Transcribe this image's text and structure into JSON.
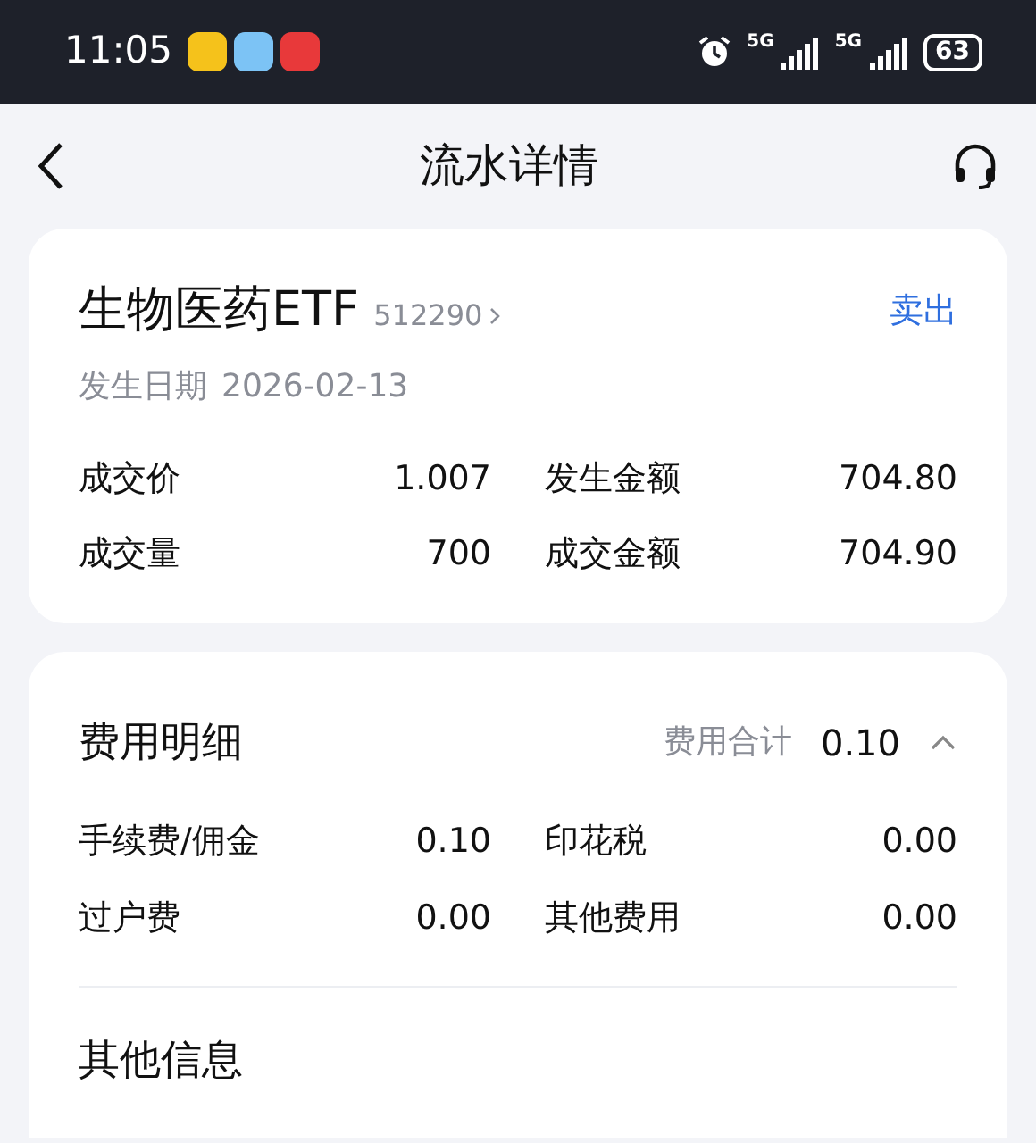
{
  "status_bar": {
    "time": "11:05",
    "networks": [
      "5G",
      "5G"
    ],
    "battery": "63"
  },
  "header": {
    "title": "流水详情"
  },
  "trade": {
    "name": "生物医药ETF",
    "code": "512290",
    "action": "卖出",
    "date_label": "发生日期",
    "date": "2026-02-13",
    "fields": [
      {
        "label": "成交价",
        "value": "1.007"
      },
      {
        "label": "发生金额",
        "value": "704.80"
      },
      {
        "label": "成交量",
        "value": "700"
      },
      {
        "label": "成交金额",
        "value": "704.90"
      }
    ]
  },
  "fees": {
    "title": "费用明细",
    "total_label": "费用合计",
    "total": "0.10",
    "expanded": true,
    "items": [
      {
        "label": "手续费/佣金",
        "value": "0.10"
      },
      {
        "label": "印花税",
        "value": "0.00"
      },
      {
        "label": "过户费",
        "value": "0.00"
      },
      {
        "label": "其他费用",
        "value": "0.00"
      }
    ]
  },
  "other": {
    "title": "其他信息"
  }
}
